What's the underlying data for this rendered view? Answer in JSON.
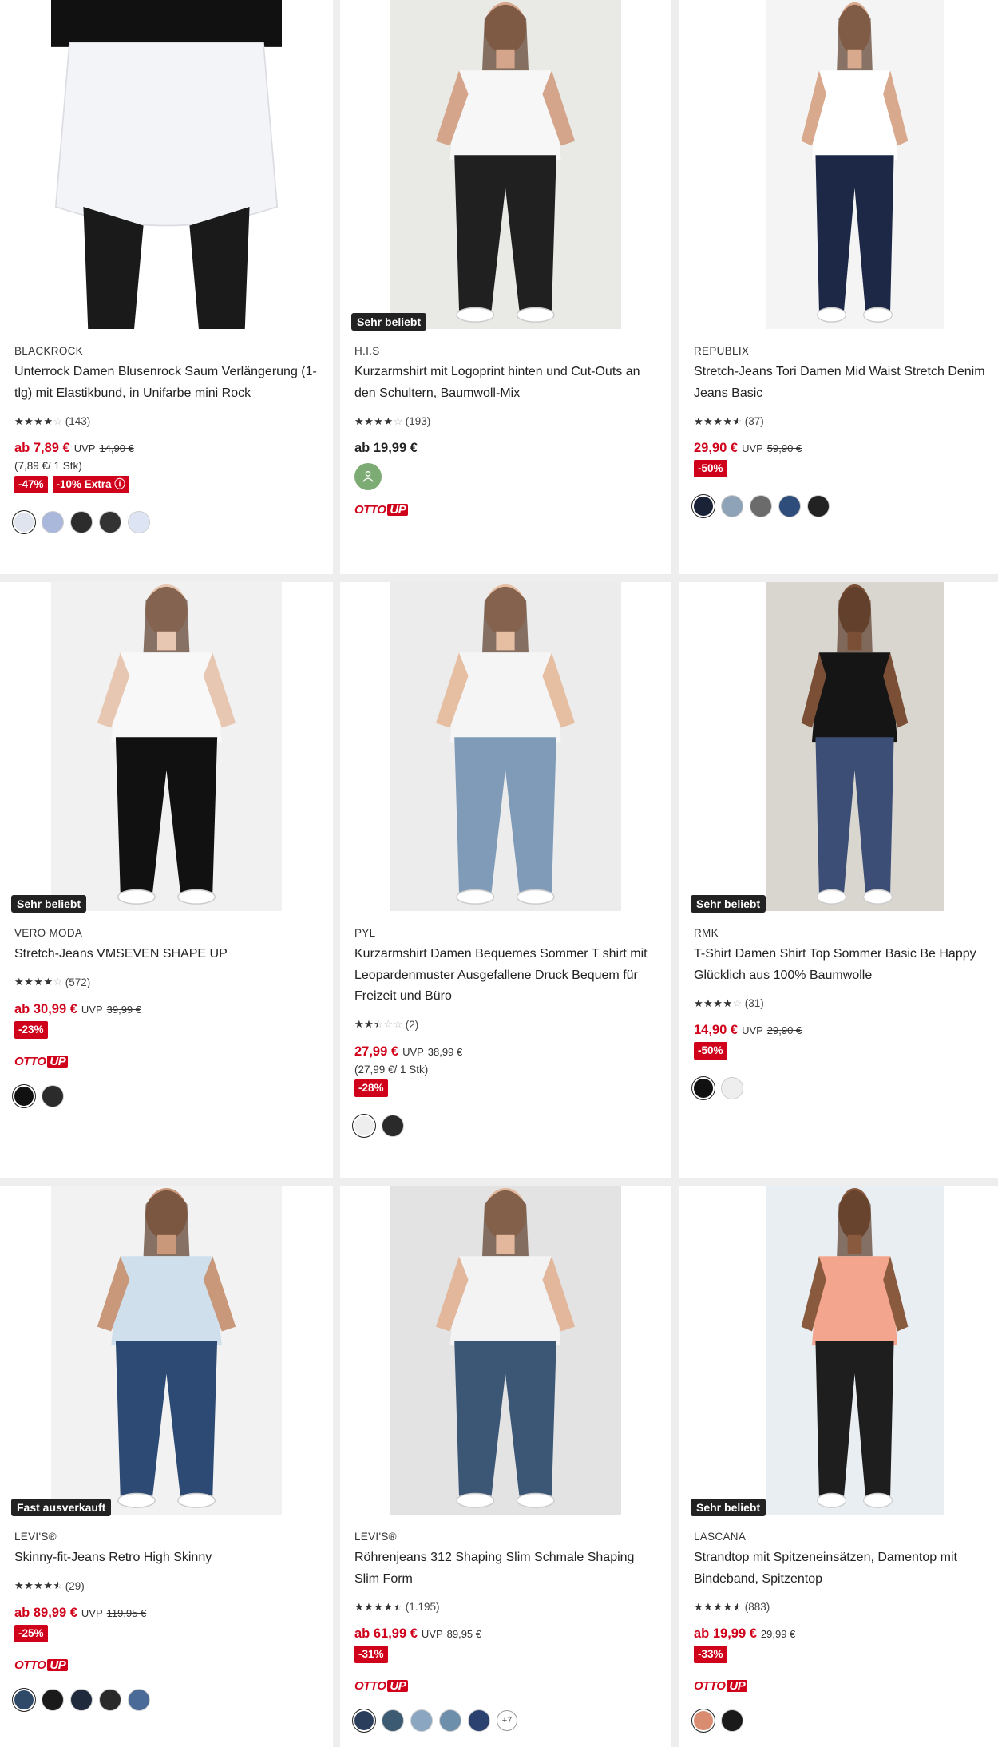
{
  "products": [
    {
      "brand": "BLACKROCK",
      "title": "Unterrock Damen Blusenrock Saum Verlängerung (1-tlg) mit Elastikbund, in Unifarbe mini Rock",
      "rating": 4,
      "reviews": "(143)",
      "price": "ab 7,89 €",
      "price_red": true,
      "uvp_label": "UVP",
      "uvp": "14,90 €",
      "unit": "(7,89 €/ 1 Stk)",
      "badges": [
        "-47%",
        "-10% Extra ⓘ"
      ],
      "flag": "",
      "otto_up": false,
      "sustainable": false,
      "swatches": [
        "#dfe4ef",
        "#aab8dc",
        "#2c2c2c",
        "#333333",
        "#dde5f5"
      ],
      "more": "",
      "image_colors": {
        "bg": "#ffffff",
        "top": "#111111",
        "skirt": "#f3f4f7",
        "legs": "#1a1a1a"
      }
    },
    {
      "brand": "H.I.S",
      "title": "Kurzarmshirt mit Logoprint hinten und Cut-Outs an den Schultern, Baumwoll-Mix",
      "rating": 4,
      "reviews": "(193)",
      "price": "ab 19,99 €",
      "price_red": false,
      "uvp_label": "",
      "uvp": "",
      "unit": "",
      "badges": [],
      "flag": "Sehr beliebt",
      "otto_up": true,
      "sustainable": true,
      "swatches": [],
      "more": "",
      "image_colors": {
        "bg": "#e9e9e6",
        "top": "#f7f7f7",
        "legs": "#202020",
        "skin": "#d4a58a"
      }
    },
    {
      "brand": "REPUBLIX",
      "title": "Stretch-Jeans Tori Damen Mid Waist Stretch Denim Jeans Basic",
      "rating": 4.5,
      "reviews": "(37)",
      "price": "29,90 €",
      "price_red": true,
      "uvp_label": "UVP",
      "uvp": "59,90 €",
      "unit": "",
      "badges": [
        "-50%"
      ],
      "flag": "",
      "otto_up": false,
      "sustainable": false,
      "swatches": [
        "#1a2238",
        "#8fa3b8",
        "#6b6b6b",
        "#2e4d7a",
        "#222222"
      ],
      "more": "",
      "image_colors": {
        "bg": "#f4f4f4",
        "top": "#ffffff",
        "legs": "#1c2846",
        "skin": "#d9a98d"
      }
    },
    {
      "brand": "VERO MODA",
      "title": "Stretch-Jeans VMSEVEN SHAPE UP",
      "rating": 4,
      "reviews": "(572)",
      "price": "ab 30,99 €",
      "price_red": true,
      "uvp_label": "UVP",
      "uvp": "39,99 €",
      "unit": "",
      "badges": [
        "-23%"
      ],
      "flag": "Sehr beliebt",
      "otto_up": true,
      "sustainable": false,
      "swatches": [
        "#111111",
        "#2b2b2b"
      ],
      "more": "",
      "image_colors": {
        "bg": "#f1f1f1",
        "top": "#f8f8f8",
        "legs": "#111111",
        "skin": "#e8c7b2"
      }
    },
    {
      "brand": "PYL",
      "title": "Kurzarmshirt Damen Bequemes Sommer T shirt mit Leopardenmuster Ausgefallene Druck Bequem für Freizeit und Büro",
      "rating": 2.5,
      "reviews": "(2)",
      "price": "27,99 €",
      "price_red": true,
      "uvp_label": "UVP",
      "uvp": "38,99 €",
      "unit": "(27,99 €/ 1 Stk)",
      "badges": [
        "-28%"
      ],
      "flag": "",
      "otto_up": false,
      "sustainable": false,
      "swatches": [
        "#eeeeee",
        "#2a2a2a"
      ],
      "more": "",
      "image_colors": {
        "bg": "#ececec",
        "top": "#f5f5f5",
        "legs": "#7f9bb8",
        "skin": "#e6bfa3"
      }
    },
    {
      "brand": "RMK",
      "title": "T-Shirt Damen Shirt Top Sommer Basic Be Happy Glücklich aus 100% Baumwolle",
      "rating": 4,
      "reviews": "(31)",
      "price": "14,90 €",
      "price_red": true,
      "uvp_label": "UVP",
      "uvp": "29,90 €",
      "unit": "",
      "badges": [
        "-50%"
      ],
      "flag": "Sehr beliebt",
      "otto_up": false,
      "sustainable": false,
      "swatches": [
        "#111111",
        "#eeeeee"
      ],
      "more": "",
      "image_colors": {
        "bg": "#d9d6d0",
        "top": "#151515",
        "legs": "#3c4e75",
        "skin": "#7a4f36"
      }
    },
    {
      "brand": "LEVI'S®",
      "title": "Skinny-fit-Jeans Retro High Skinny",
      "rating": 4.5,
      "reviews": "(29)",
      "price": "ab 89,99 €",
      "price_red": true,
      "uvp_label": "UVP",
      "uvp": "119,95 €",
      "unit": "",
      "badges": [
        "-25%"
      ],
      "flag": "Fast ausverkauft",
      "otto_up": true,
      "sustainable": false,
      "swatches": [
        "#2f4a68",
        "#1a1a1a",
        "#1f2a3c",
        "#2a2a2a",
        "#4a6a97"
      ],
      "more": "",
      "image_colors": {
        "bg": "#f2f2f2",
        "top": "#cfe0ec",
        "legs": "#2c4a73",
        "skin": "#c99779"
      }
    },
    {
      "brand": "LEVI'S®",
      "title": "Röhrenjeans 312 Shaping Slim Schmale Shaping Slim Form",
      "rating": 4.5,
      "reviews": "(1.195)",
      "price": "ab 61,99 €",
      "price_red": true,
      "uvp_label": "UVP",
      "uvp": "89,95 €",
      "unit": "",
      "badges": [
        "-31%"
      ],
      "flag": "",
      "otto_up": true,
      "sustainable": false,
      "swatches": [
        "#2b3e5c",
        "#3d5a73",
        "#8ba6c1",
        "#6e8fab",
        "#2b4270"
      ],
      "more": "+7",
      "image_colors": {
        "bg": "#e3e3e3",
        "top": "#f3f3f3",
        "legs": "#3c5676",
        "skin": "#e2b79c"
      }
    },
    {
      "brand": "LASCANA",
      "title": "Strandtop mit Spitzeneinsätzen, Damentop mit Bindeband, Spitzentop",
      "rating": 4.5,
      "reviews": "(883)",
      "price": "ab 19,99 €",
      "price_red": true,
      "uvp_label": "",
      "uvp": "29,99 €",
      "unit": "",
      "badges": [
        "-33%"
      ],
      "flag": "Sehr beliebt",
      "otto_up": true,
      "sustainable": false,
      "swatches": [
        "#d98c70",
        "#1a1a1a"
      ],
      "more": "",
      "image_colors": {
        "bg": "#e8eef2",
        "top": "#f4a58e",
        "legs": "#1e1e1e",
        "skin": "#8a5a3f"
      }
    }
  ],
  "otto_label": "OTTO",
  "up_label": "UP"
}
